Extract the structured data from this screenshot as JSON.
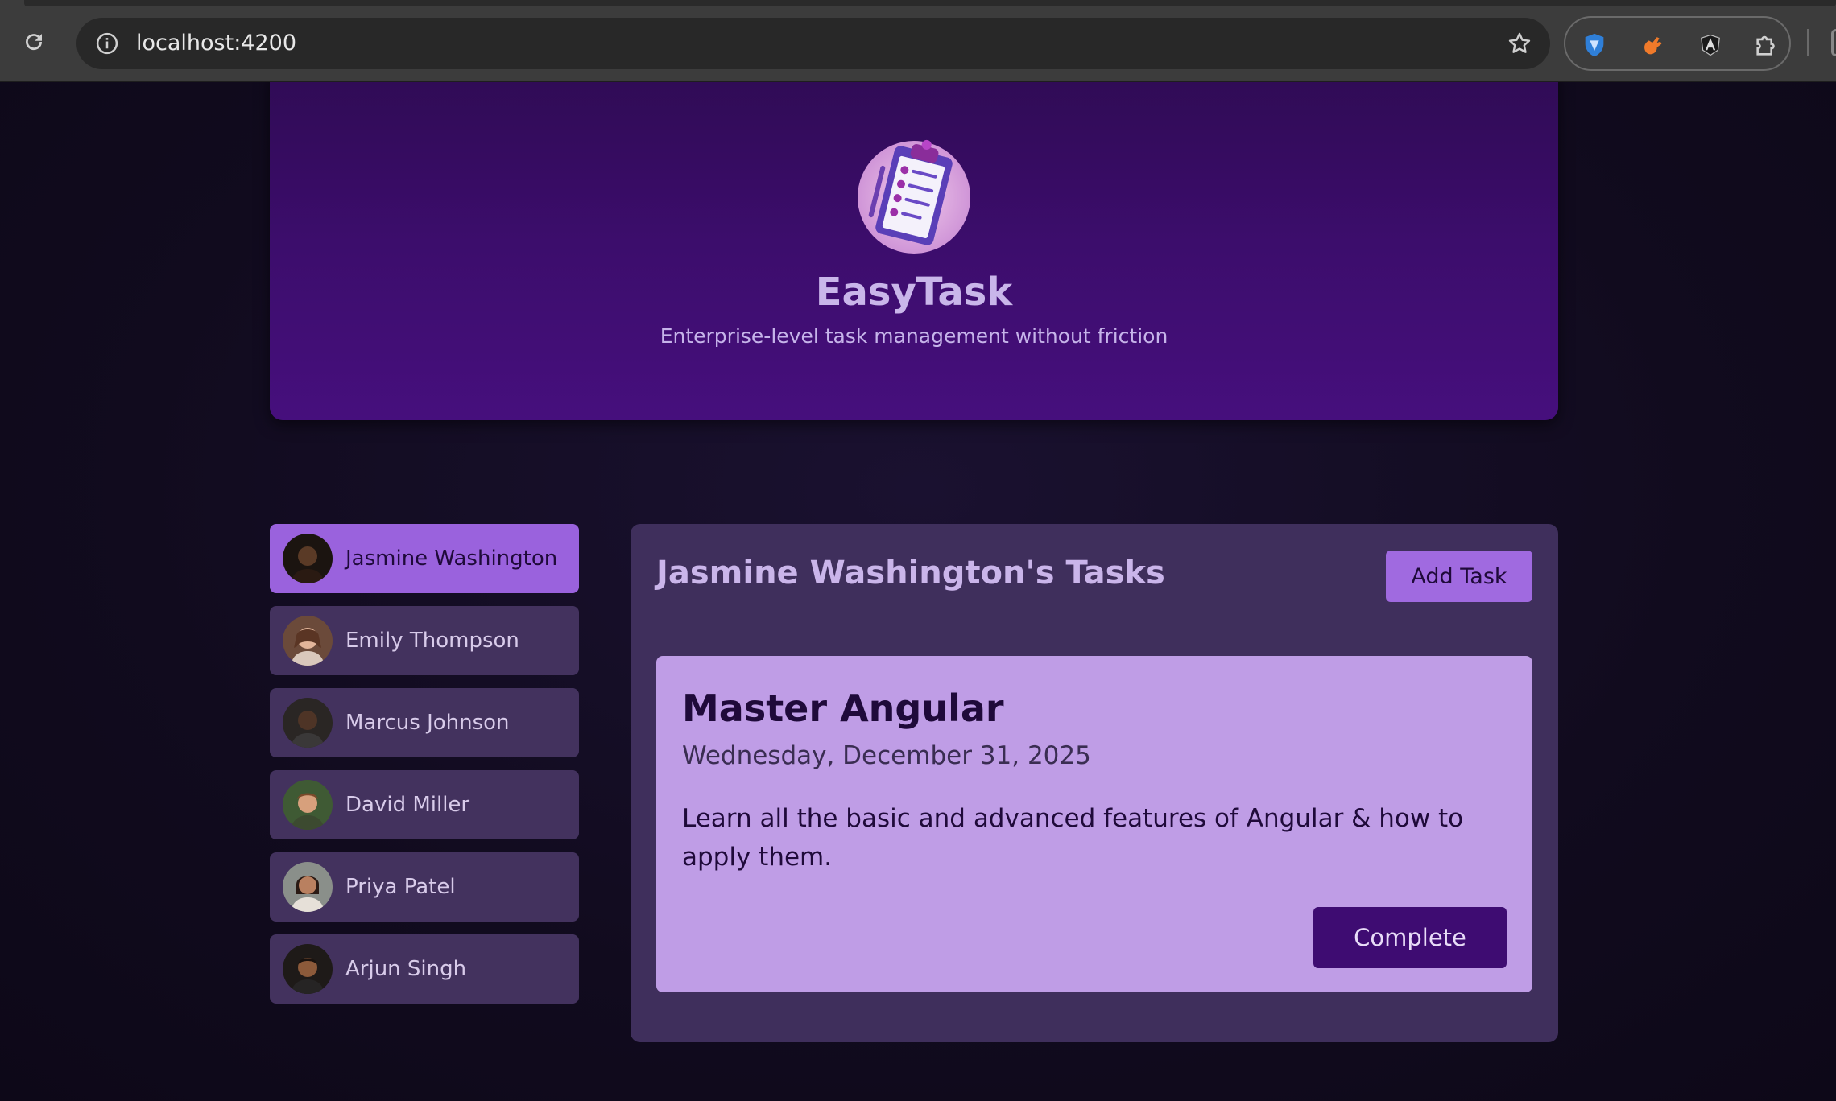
{
  "browser": {
    "url": "localhost:4200"
  },
  "header": {
    "title": "EasyTask",
    "subtitle": "Enterprise-level task management without friction",
    "logo_icon": "clipboard-checklist-icon"
  },
  "users": [
    {
      "name": "Jasmine Washington",
      "selected": true,
      "skin": "#5a3a26"
    },
    {
      "name": "Emily Thompson",
      "selected": false,
      "skin": "#e2b59a"
    },
    {
      "name": "Marcus Johnson",
      "selected": false,
      "skin": "#4e3426"
    },
    {
      "name": "David Miller",
      "selected": false,
      "skin": "#d7a07c"
    },
    {
      "name": "Priya Patel",
      "selected": false,
      "skin": "#b98060"
    },
    {
      "name": "Arjun Singh",
      "selected": false,
      "skin": "#8c5a3a"
    }
  ],
  "tasks_panel": {
    "title": "Jasmine Washington's Tasks",
    "add_label": "Add Task",
    "task": {
      "title": "Master Angular",
      "date": "Wednesday, December 31, 2025",
      "description": "Learn all the basic and advanced features of Angular & how to apply them.",
      "complete_label": "Complete"
    }
  },
  "colors": {
    "accent": "#a06ae0",
    "selected_user": "#9a62dd",
    "card": "#bf9de6",
    "complete_button": "#3e0c72"
  }
}
